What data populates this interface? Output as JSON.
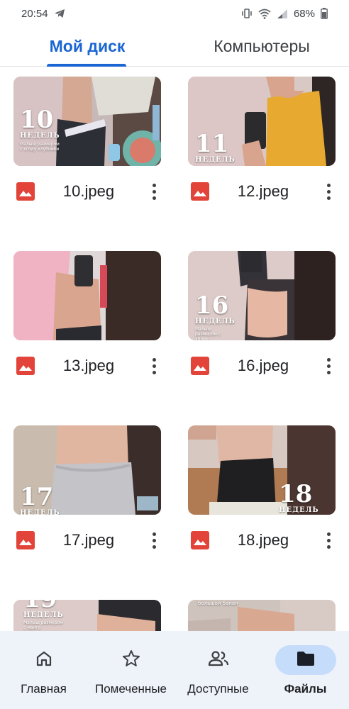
{
  "status_bar": {
    "time": "20:54",
    "battery": "68%",
    "icons": [
      "telegram-icon",
      "vibrate-icon",
      "wifi-icon",
      "signal-icon",
      "battery-icon"
    ]
  },
  "tabs": [
    {
      "label": "Мой диск",
      "active": true
    },
    {
      "label": "Компьютеры",
      "active": false
    }
  ],
  "files": [
    {
      "name": "10.jpeg",
      "type": "image",
      "icon": "image-file-icon",
      "week_number": "10",
      "week_word": "НЕДЕЛЬ",
      "caption": "Малыш размером с ягоду клубники"
    },
    {
      "name": "12.jpeg",
      "type": "image",
      "icon": "image-file-icon",
      "week_number": "11",
      "week_word": "НЕДЕЛЬ",
      "caption": ""
    },
    {
      "name": "13.jpeg",
      "type": "image",
      "icon": "image-file-icon",
      "week_number": "",
      "week_word": "",
      "caption": ""
    },
    {
      "name": "16.jpeg",
      "type": "image",
      "icon": "image-file-icon",
      "week_number": "16",
      "week_word": "НЕДЕЛЬ",
      "caption": "Малыш размером с яблоко"
    },
    {
      "name": "17.jpeg",
      "type": "image",
      "icon": "image-file-icon",
      "week_number": "17",
      "week_word": "НЕДЕЛЬ",
      "caption": ""
    },
    {
      "name": "18.jpeg",
      "type": "image",
      "icon": "image-file-icon",
      "week_number": "18",
      "week_word": "НЕДЕЛЬ",
      "caption": ""
    },
    {
      "name": "",
      "type": "image",
      "icon": "image-file-icon",
      "week_number": "19",
      "week_word": "НЕДЕЛЬ",
      "caption": "Малыш размером с манго"
    },
    {
      "name": "",
      "type": "image",
      "icon": "image-file-icon",
      "week_number": "",
      "week_word": "",
      "caption": "большой банан"
    }
  ],
  "bottom_nav": [
    {
      "label": "Главная",
      "icon": "home-icon",
      "active": false
    },
    {
      "label": "Помеченные",
      "icon": "star-icon",
      "active": false
    },
    {
      "label": "Доступные",
      "icon": "shared-people-icon",
      "active": false
    },
    {
      "label": "Файлы",
      "icon": "folder-icon",
      "active": true
    }
  ],
  "colors": {
    "accent": "#1a66d2",
    "file_icon_red": "#e2443a",
    "nav_background": "#eef2f9",
    "nav_active_pill": "#c6dcfb"
  }
}
